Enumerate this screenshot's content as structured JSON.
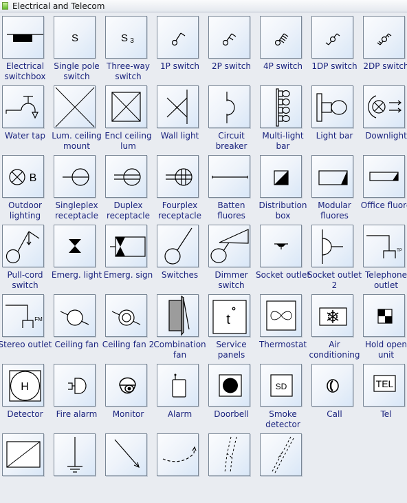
{
  "panel": {
    "title": "Electrical and Telecom",
    "icon": "stencil-icon"
  },
  "shapes": [
    {
      "label": "Electrical switchbox",
      "icon": "electrical-switchbox-icon"
    },
    {
      "label": "Single pole switch",
      "icon": "single-pole-switch-icon",
      "glyph": "S"
    },
    {
      "label": "Three-way switch",
      "icon": "three-way-switch-icon",
      "glyph": "S",
      "subscript": "3"
    },
    {
      "label": "1P switch",
      "icon": "1p-switch-icon"
    },
    {
      "label": "2P switch",
      "icon": "2p-switch-icon"
    },
    {
      "label": "4P switch",
      "icon": "4p-switch-icon"
    },
    {
      "label": "1DP switch",
      "icon": "1dp-switch-icon"
    },
    {
      "label": "2DP switch",
      "icon": "2dp-switch-icon"
    },
    {
      "label": "Water tap",
      "icon": "water-tap-icon"
    },
    {
      "label": "Lum. ceiling mount",
      "icon": "lum-ceiling-mount-icon"
    },
    {
      "label": "Encl ceiling lum",
      "icon": "encl-ceiling-lum-icon"
    },
    {
      "label": "Wall light",
      "icon": "wall-light-icon"
    },
    {
      "label": "Circuit breaker",
      "icon": "circuit-breaker-icon"
    },
    {
      "label": "Multi-light bar",
      "icon": "multi-light-bar-icon"
    },
    {
      "label": "Light bar",
      "icon": "light-bar-icon"
    },
    {
      "label": "Downlight",
      "icon": "downlight-icon"
    },
    {
      "label": "Outdoor lighting",
      "icon": "outdoor-lighting-icon",
      "glyph": "B"
    },
    {
      "label": "Singleplex receptacle",
      "icon": "singleplex-receptacle-icon"
    },
    {
      "label": "Duplex receptacle",
      "icon": "duplex-receptacle-icon"
    },
    {
      "label": "Fourplex receptacle",
      "icon": "fourplex-receptacle-icon"
    },
    {
      "label": "Batten fluores",
      "icon": "batten-fluores-icon"
    },
    {
      "label": "Distribution box",
      "icon": "distribution-box-icon"
    },
    {
      "label": "Modular fluores",
      "icon": "modular-fluores-icon"
    },
    {
      "label": "Office fluore",
      "icon": "office-fluore-icon"
    },
    {
      "label": "Pull-cord switch",
      "icon": "pull-cord-switch-icon"
    },
    {
      "label": "Emerg. light",
      "icon": "emerg-light-icon"
    },
    {
      "label": "Emerg. sign",
      "icon": "emerg-sign-icon"
    },
    {
      "label": "Switches",
      "icon": "switches-icon"
    },
    {
      "label": "Dimmer switch",
      "icon": "dimmer-switch-icon"
    },
    {
      "label": "Socket outlet",
      "icon": "socket-outlet-icon"
    },
    {
      "label": "Socket outlet 2",
      "icon": "socket-outlet-2-icon"
    },
    {
      "label": "Telephone outlet",
      "icon": "telephone-outlet-icon",
      "glyph": "TP"
    },
    {
      "label": "Stereo outlet",
      "icon": "stereo-outlet-icon",
      "glyph": "FM"
    },
    {
      "label": "Ceiling fan",
      "icon": "ceiling-fan-icon"
    },
    {
      "label": "Ceiling fan 2",
      "icon": "ceiling-fan-2-icon"
    },
    {
      "label": "Combination fan",
      "icon": "combination-fan-icon"
    },
    {
      "label": "Service panels",
      "icon": "service-panels-icon",
      "glyph": "t°"
    },
    {
      "label": "Thermostat",
      "icon": "thermostat-icon"
    },
    {
      "label": "Air conditioning",
      "icon": "air-conditioning-icon"
    },
    {
      "label": "Hold open unit",
      "icon": "hold-open-unit-icon"
    },
    {
      "label": "Detector",
      "icon": "detector-icon",
      "glyph": "H"
    },
    {
      "label": "Fire alarm",
      "icon": "fire-alarm-icon"
    },
    {
      "label": "Monitor",
      "icon": "monitor-icon"
    },
    {
      "label": "Alarm",
      "icon": "alarm-icon"
    },
    {
      "label": "Doorbell",
      "icon": "doorbell-icon"
    },
    {
      "label": "Smoke detector",
      "icon": "smoke-detector-icon",
      "glyph": "SD"
    },
    {
      "label": "Call",
      "icon": "call-icon"
    },
    {
      "label": "Tel",
      "icon": "tel-icon",
      "glyph": "TEL"
    },
    {
      "label": "",
      "icon": "transformer-icon"
    },
    {
      "label": "",
      "icon": "ground-icon"
    },
    {
      "label": "",
      "icon": "arrow-line-icon"
    },
    {
      "label": "",
      "icon": "dashed-curve-icon"
    },
    {
      "label": "",
      "icon": "dashed-cable-icon"
    },
    {
      "label": "",
      "icon": "dashed-cable-2-icon"
    }
  ]
}
